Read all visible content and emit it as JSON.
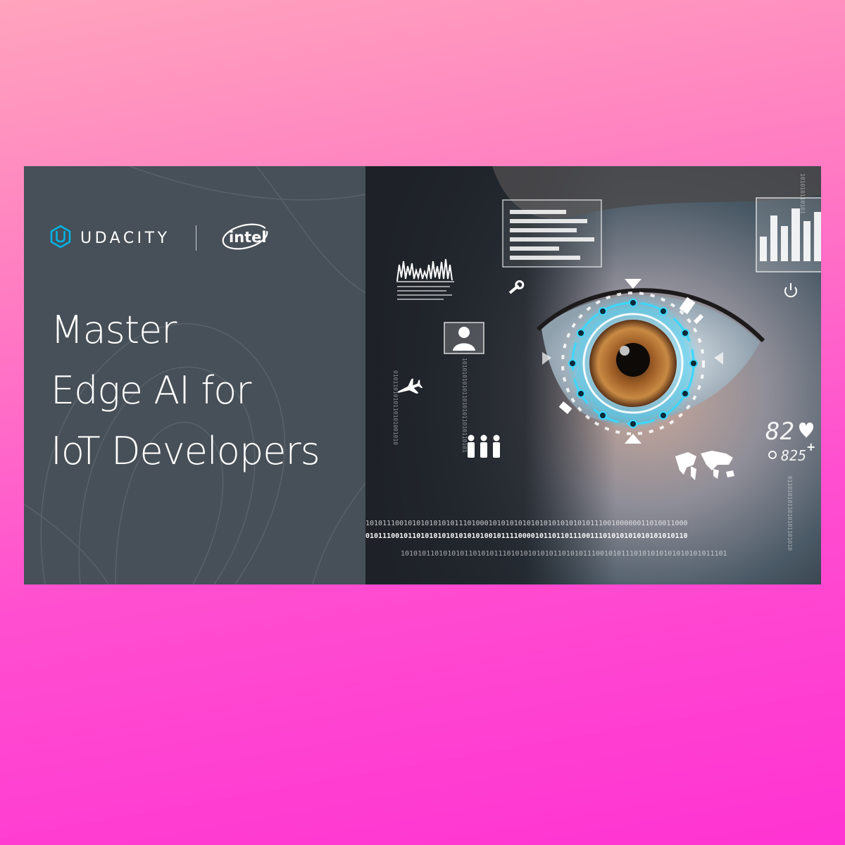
{
  "brand": {
    "udacity_label": "UDACITY",
    "intel_label": "intel"
  },
  "headline": {
    "lines": [
      "Master",
      "Edge AI for",
      "IoT Developers"
    ]
  },
  "hud": {
    "digital_readout": "82",
    "small_readout": "825",
    "binary_line_1": "1010111001010101010101110100010101010101010101010101011100100000011010011000",
    "binary_line_2": "0101110010110101010101010101001011110000101101101110011101010101010101010110",
    "binary_line_3": "10101011010101011010101110101010101011010101110010101110101010101010101011101"
  },
  "colors": {
    "page_gradient_top": "#ffa4bd",
    "page_gradient_bottom": "#ff33d2",
    "panel": "#474f58",
    "udacity_blue": "#02b3e4",
    "hud_cyan": "#3ad8ff"
  }
}
